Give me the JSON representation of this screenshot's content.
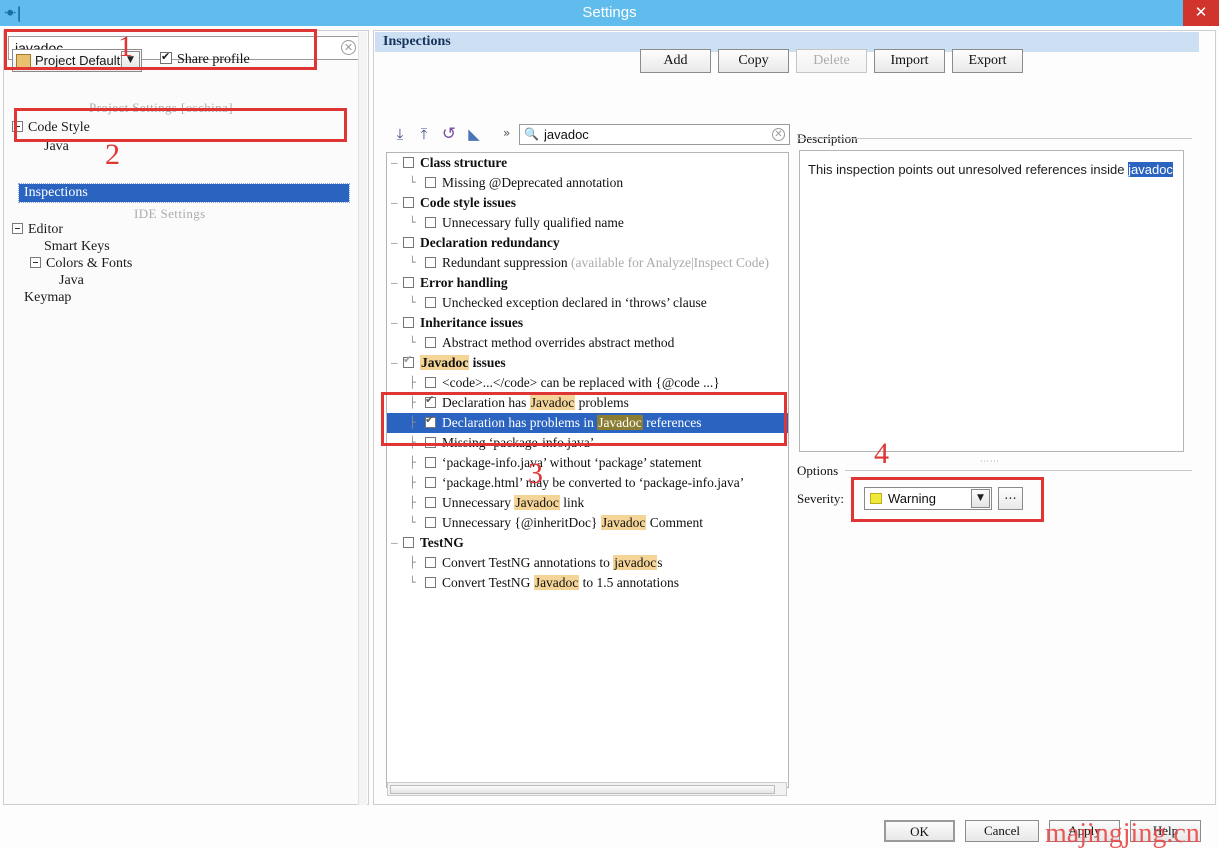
{
  "window": {
    "title": "Settings",
    "app_icon": "idea-icon",
    "close_label": "✕",
    "titlebar_color": "#5fbcec",
    "close_color": "#d0342c"
  },
  "left_panel": {
    "search": {
      "value": "javadoc",
      "placeholder": "",
      "clear_icon": "clear-circle-icon"
    },
    "groups": [
      {
        "label": "Project Settings [oschina]"
      },
      {
        "label": "IDE Settings"
      }
    ],
    "tree": [
      {
        "label": "Code Style",
        "expandable": true,
        "selected": false
      },
      {
        "label": "Java",
        "expandable": false,
        "selected": false
      },
      {
        "label": "Inspections",
        "expandable": false,
        "selected": true
      },
      {
        "label": "Editor",
        "expandable": true,
        "selected": false
      },
      {
        "label": "Smart Keys",
        "expandable": false,
        "selected": false
      },
      {
        "label": "Colors & Fonts",
        "expandable": true,
        "selected": false
      },
      {
        "label": "Java",
        "expandable": false,
        "selected": false
      },
      {
        "label": "Keymap",
        "expandable": false,
        "selected": false
      }
    ]
  },
  "right_panel": {
    "header": "Inspections",
    "profile": {
      "value": "Project Default",
      "icon": "profile-icon",
      "arrow": "▼"
    },
    "share_profile": {
      "label": "Share profile",
      "mnemonic": "S",
      "checked": true
    },
    "buttons": [
      {
        "label": "Add",
        "mnemonic": "d",
        "enabled": true
      },
      {
        "label": "Copy",
        "mnemonic": "o",
        "enabled": true
      },
      {
        "label": "Delete",
        "mnemonic": "l",
        "enabled": false
      },
      {
        "label": "Import",
        "mnemonic": "I",
        "enabled": true
      },
      {
        "label": "Export",
        "mnemonic": "E",
        "enabled": true
      }
    ],
    "tree_toolbar": [
      {
        "icon": "expand-all-icon",
        "glyph": "⤓"
      },
      {
        "icon": "collapse-all-icon",
        "glyph": "⤒"
      },
      {
        "icon": "reset-icon",
        "glyph": "↺"
      },
      {
        "icon": "eraser-icon",
        "glyph": "◣"
      }
    ],
    "tree_chevron": "»",
    "tree_search": {
      "value": "javadoc",
      "icon": "search-icon",
      "clear_icon": "clear-circle-icon"
    }
  },
  "inspections": [
    {
      "label": "Class structure",
      "group": true,
      "indent": 0,
      "check": "empty",
      "selected": false,
      "highlight": ""
    },
    {
      "label": "Missing @Deprecated annotation",
      "group": false,
      "indent": 1,
      "check": "empty",
      "selected": false,
      "highlight": ""
    },
    {
      "label": "Code style issues",
      "group": true,
      "indent": 0,
      "check": "empty",
      "selected": false,
      "highlight": ""
    },
    {
      "label": "Unnecessary fully qualified name",
      "group": false,
      "indent": 1,
      "check": "empty",
      "selected": false,
      "highlight": ""
    },
    {
      "label": "Declaration redundancy",
      "group": true,
      "indent": 0,
      "check": "empty",
      "selected": false,
      "highlight": ""
    },
    {
      "label": "Redundant suppression",
      "suffix": " (available for Analyze|Inspect Code)",
      "group": false,
      "indent": 1,
      "check": "empty",
      "selected": false,
      "highlight": ""
    },
    {
      "label": "Error handling",
      "group": true,
      "indent": 0,
      "check": "empty",
      "selected": false,
      "highlight": ""
    },
    {
      "label": "Unchecked exception declared in ‘throws’ clause",
      "group": false,
      "indent": 1,
      "check": "empty",
      "selected": false,
      "highlight": ""
    },
    {
      "label": "Inheritance issues",
      "group": true,
      "indent": 0,
      "check": "empty",
      "selected": false,
      "highlight": ""
    },
    {
      "label": "Abstract method overrides abstract method",
      "group": false,
      "indent": 1,
      "check": "empty",
      "selected": false,
      "highlight": ""
    },
    {
      "label": "Javadoc issues",
      "group": true,
      "indent": 0,
      "check": "partial",
      "selected": false,
      "highlight": "Javadoc"
    },
    {
      "label": "<code>...</code> can be replaced with {@code ...}",
      "group": false,
      "indent": 1,
      "check": "empty",
      "selected": false,
      "highlight": ""
    },
    {
      "label": "Declaration has Javadoc problems",
      "group": false,
      "indent": 1,
      "check": "checked",
      "selected": false,
      "highlight": "Javadoc"
    },
    {
      "label": "Declaration has problems in Javadoc references",
      "group": false,
      "indent": 1,
      "check": "checked",
      "selected": true,
      "highlight": "Javadoc"
    },
    {
      "label": "Missing ‘package-info.java’",
      "group": false,
      "indent": 1,
      "check": "empty",
      "selected": false,
      "highlight": ""
    },
    {
      "label": "‘package-info.java’ without ‘package’ statement",
      "group": false,
      "indent": 1,
      "check": "empty",
      "selected": false,
      "highlight": ""
    },
    {
      "label": "‘package.html’ may be converted to ‘package-info.java’",
      "group": false,
      "indent": 1,
      "check": "empty",
      "selected": false,
      "highlight": ""
    },
    {
      "label": "Unnecessary Javadoc link",
      "group": false,
      "indent": 1,
      "check": "empty",
      "selected": false,
      "highlight": "Javadoc"
    },
    {
      "label": "Unnecessary {@inheritDoc} Javadoc Comment",
      "group": false,
      "indent": 1,
      "check": "empty",
      "selected": false,
      "highlight": "Javadoc"
    },
    {
      "label": "TestNG",
      "group": true,
      "indent": 0,
      "check": "empty",
      "selected": false,
      "highlight": ""
    },
    {
      "label": "Convert TestNG annotations to javadocs",
      "group": false,
      "indent": 1,
      "check": "empty",
      "selected": false,
      "highlight": "javadoc"
    },
    {
      "label": "Convert TestNG Javadoc to 1.5 annotations",
      "group": false,
      "indent": 1,
      "check": "empty",
      "selected": false,
      "highlight": "Javadoc"
    }
  ],
  "description": {
    "label": "Description",
    "text_before": "This inspection points out unresolved references inside ",
    "selected_word": "javadoc"
  },
  "options": {
    "label": "Options",
    "severity_label": "Severity:",
    "severity_mnemonic": "v",
    "severity_value": "Warning",
    "severity_color": "#f2e83a",
    "severity_arrow": "▼",
    "more_button": "..."
  },
  "footer": {
    "ok": "OK",
    "cancel": "Cancel",
    "apply": "Apply",
    "help": "Help",
    "watermark": "majingjing.cn"
  },
  "annotations": [
    {
      "number": "1"
    },
    {
      "number": "2"
    },
    {
      "number": "3"
    },
    {
      "number": "4"
    }
  ]
}
